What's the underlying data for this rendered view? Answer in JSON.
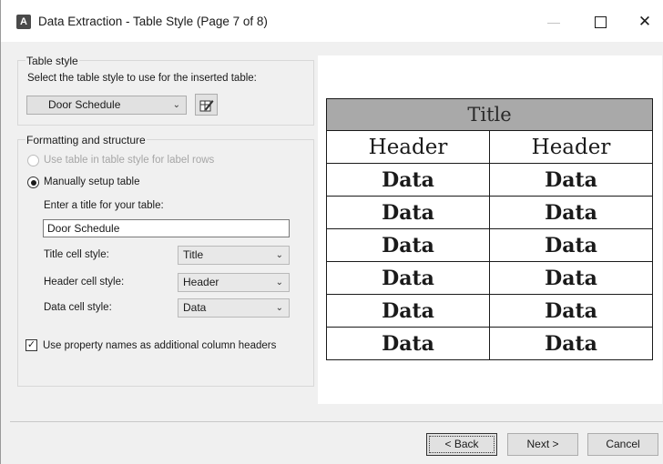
{
  "window": {
    "title": "Data Extraction - Table Style (Page 7 of 8)",
    "app_icon": "autocad-icon",
    "minimize_glyph": "—",
    "close_glyph": "✕"
  },
  "table_style": {
    "group_label": "Table style",
    "prompt": "Select the table style to use for the inserted table:",
    "selected": "Door Schedule",
    "edit_icon": "table-style-edit-icon"
  },
  "formatting": {
    "group_label": "Formatting and structure",
    "use_table_label": "Use table in table style for label rows",
    "manual_label": "Manually setup table",
    "title_prompt": "Enter a title for your table:",
    "title_value": "Door Schedule",
    "title_cell_label": "Title cell style:",
    "title_cell_value": "Title",
    "header_cell_label": "Header cell style:",
    "header_cell_value": "Header",
    "data_cell_label": "Data cell style:",
    "data_cell_value": "Data",
    "property_names_label": "Use property names as additional column headers",
    "property_names_checked": true
  },
  "preview": {
    "title": "Title",
    "headers": [
      "Header",
      "Header"
    ],
    "rows": [
      [
        "Data",
        "Data"
      ],
      [
        "Data",
        "Data"
      ],
      [
        "Data",
        "Data"
      ],
      [
        "Data",
        "Data"
      ],
      [
        "Data",
        "Data"
      ],
      [
        "Data",
        "Data"
      ]
    ]
  },
  "buttons": {
    "back": "< Back",
    "next": "Next >",
    "cancel": "Cancel"
  },
  "colors": {
    "title_cell_fill": "#a9a9a9",
    "dialog_bg": "#f0f0f0"
  }
}
